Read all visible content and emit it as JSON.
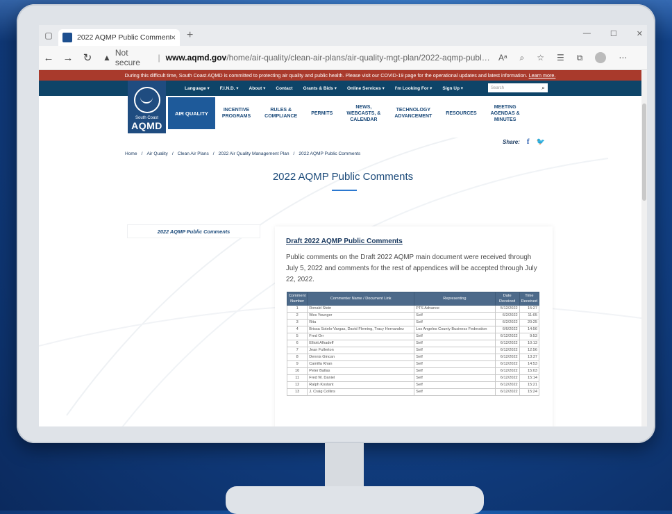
{
  "browser": {
    "tab_title": "2022 AQMP Public Comments",
    "tab_close": "×",
    "new_tab": "+",
    "url_security": "Not secure",
    "url_domain": "www.aqmd.gov",
    "url_path": "/home/air-quality/clean-air-plans/air-quality-mgt-plan/2022-aqmp-public-com...",
    "icons": [
      "tab-actions-icon",
      "back-icon",
      "forward-icon",
      "refresh-icon",
      "warning-icon",
      "read-aloud-icon",
      "zoom-icon",
      "favorite-icon",
      "favorites-list-icon",
      "collections-icon",
      "profile-avatar",
      "more-icon",
      "minimize-icon",
      "maximize-icon",
      "close-icon"
    ]
  },
  "notice": {
    "text": "During this difficult time, South Coast AQMD is committed to protecting air quality and public health. Please visit our COVID-19 page for the operational updates and latest information.",
    "link": "Learn more."
  },
  "utility_nav": {
    "items": [
      "Language ▾",
      "F.I.N.D. ▾",
      "About ▾",
      "Contact",
      "Grants & Bids ▾",
      "Online Services ▾",
      "I'm Looking For ▾",
      "Sign Up ▾"
    ],
    "search_placeholder": "Search"
  },
  "logo": {
    "line1": "South Coast",
    "line2": "AQMD"
  },
  "main_nav": {
    "items": [
      "AIR QUALITY",
      "INCENTIVE\nPROGRAMS",
      "RULES &\nCOMPLIANCE",
      "PERMITS",
      "NEWS,\nWEBCASTS, &\nCALENDAR",
      "TECHNOLOGY\nADVANCEMENT",
      "RESOURCES",
      "MEETING\nAGENDAS &\nMINUTES"
    ]
  },
  "share_label": "Share:",
  "breadcrumb": [
    "Home",
    "Air Quality",
    "Clean Air Plans",
    "2022 Air Quality Management Plan",
    "2022 AQMP Public Comments"
  ],
  "breadcrumb_sep": "/",
  "page_title": "2022 AQMP Public Comments",
  "sidebar_link": "2022 AQMP Public Comments",
  "content": {
    "heading": "Draft 2022 AQMP Public Comments",
    "paragraph": "Public comments on the Draft 2022 AQMP main document were received through July 5, 2022 and comments for the rest of appendices will be accepted through July 22, 2022."
  },
  "table": {
    "headers": [
      "Comment Number",
      "Commenter Name / Document Link",
      "Representing",
      "Date Received",
      "Time Received"
    ],
    "rows": [
      [
        "1",
        "Ronald Stein",
        "PTS Advance",
        "5/12/2022",
        "15:27"
      ],
      [
        "2",
        "Wes Younger",
        "Self",
        "6/2/2022",
        "11:05"
      ],
      [
        "3",
        "Rita",
        "Self",
        "6/2/2022",
        "20:25"
      ],
      [
        "4",
        "Brissa Sotelo-Vargas, David Fleming, Tracy Hernandez",
        "Los Angeles County Business Federation",
        "6/6/2022",
        "14:56"
      ],
      [
        "5",
        "Fred Orr",
        "Self",
        "6/12/2022",
        "9:53"
      ],
      [
        "6",
        "Elliott Alhadeff",
        "Self",
        "6/12/2022",
        "10:13"
      ],
      [
        "7",
        "Jean Fullerton",
        "Self",
        "6/12/2022",
        "12:56"
      ],
      [
        "8",
        "Dennis Gincan",
        "Self",
        "6/12/2022",
        "13:37"
      ],
      [
        "9",
        "Camilla Khan",
        "Self",
        "6/12/2022",
        "14:53"
      ],
      [
        "10",
        "Peter Ballas",
        "Self",
        "6/12/2022",
        "15:03"
      ],
      [
        "11",
        "Fred W. Daniel",
        "Self",
        "6/12/2022",
        "15:14"
      ],
      [
        "12",
        "Ralph Kostant",
        "Self",
        "6/12/2022",
        "15:21"
      ],
      [
        "13",
        "J. Craig Collins",
        "Self",
        "6/12/2022",
        "15:24"
      ]
    ]
  },
  "colors": {
    "notice_bg": "#a93a2c",
    "utility_bg": "#0e4468",
    "nav_active": "#1e5a9a",
    "table_header": "#4d6a8a",
    "link": "#2b5fb0"
  }
}
